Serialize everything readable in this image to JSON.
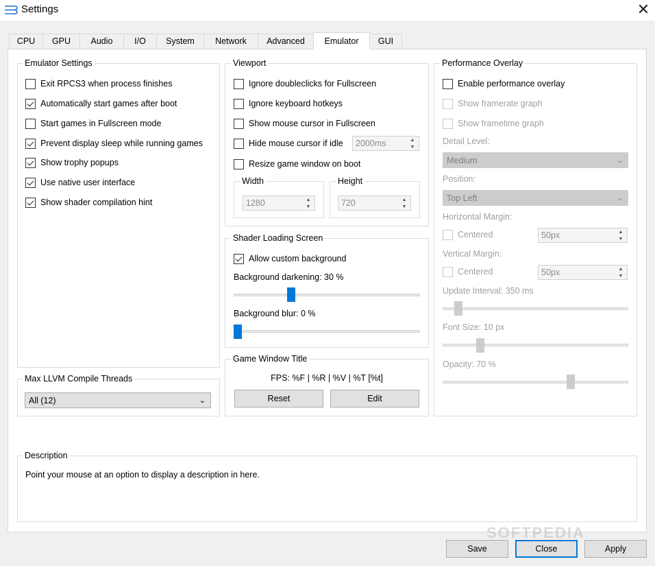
{
  "window": {
    "title": "Settings",
    "close_glyph": "✕"
  },
  "tabs": [
    "CPU",
    "GPU",
    "Audio",
    "I/O",
    "System",
    "Network",
    "Advanced",
    "Emulator",
    "GUI"
  ],
  "emulator_settings": {
    "title": "Emulator Settings",
    "items": [
      {
        "label": "Exit RPCS3 when process finishes",
        "checked": false
      },
      {
        "label": "Automatically start games after boot",
        "checked": true
      },
      {
        "label": "Start games in Fullscreen mode",
        "checked": false
      },
      {
        "label": "Prevent display sleep while running games",
        "checked": true
      },
      {
        "label": "Show trophy popups",
        "checked": true
      },
      {
        "label": "Use native user interface",
        "checked": true
      },
      {
        "label": "Show shader compilation hint",
        "checked": true
      }
    ]
  },
  "llvm": {
    "title": "Max LLVM Compile Threads",
    "value": "All (12)"
  },
  "viewport": {
    "title": "Viewport",
    "ignore_doubleclicks": "Ignore doubleclicks for Fullscreen",
    "ignore_hotkeys": "Ignore keyboard hotkeys",
    "show_cursor": "Show mouse cursor in Fullscreen",
    "hide_cursor": "Hide mouse cursor if idle",
    "hide_cursor_value": "2000ms",
    "resize_window": "Resize game window on boot",
    "width_label": "Width",
    "width_value": "1280",
    "height_label": "Height",
    "height_value": "720"
  },
  "shader_loading": {
    "title": "Shader Loading Screen",
    "allow_bg": "Allow custom background",
    "darkening_label": "Background darkening: 30 %",
    "darkening_value": 30,
    "blur_label": "Background blur: 0 %",
    "blur_value": 0
  },
  "game_window_title": {
    "title": "Game Window Title",
    "format": "FPS: %F | %R | %V | %T [%t]",
    "reset": "Reset",
    "edit": "Edit"
  },
  "performance_overlay": {
    "title": "Performance Overlay",
    "enable": "Enable performance overlay",
    "framerate_graph": "Show framerate graph",
    "frametime_graph": "Show frametime graph",
    "detail_level_label": "Detail Level:",
    "detail_level_value": "Medium",
    "position_label": "Position:",
    "position_value": "Top Left",
    "h_margin_label": "Horizontal Margin:",
    "h_centered": "Centered",
    "h_margin_value": "50px",
    "v_margin_label": "Vertical Margin:",
    "v_centered": "Centered",
    "v_margin_value": "50px",
    "update_interval_label": "Update Interval: 350 ms",
    "font_size_label": "Font Size: 10 px",
    "opacity_label": "Opacity: 70 %",
    "opacity_value": 70
  },
  "description": {
    "title": "Description",
    "text": "Point your mouse at an option to display a description in here."
  },
  "footer": {
    "save": "Save",
    "close": "Close",
    "apply": "Apply"
  },
  "watermark": "SOFTPEDIA",
  "colors": {
    "accent": "#0078d7",
    "disabled_text": "#a0a0a0"
  }
}
